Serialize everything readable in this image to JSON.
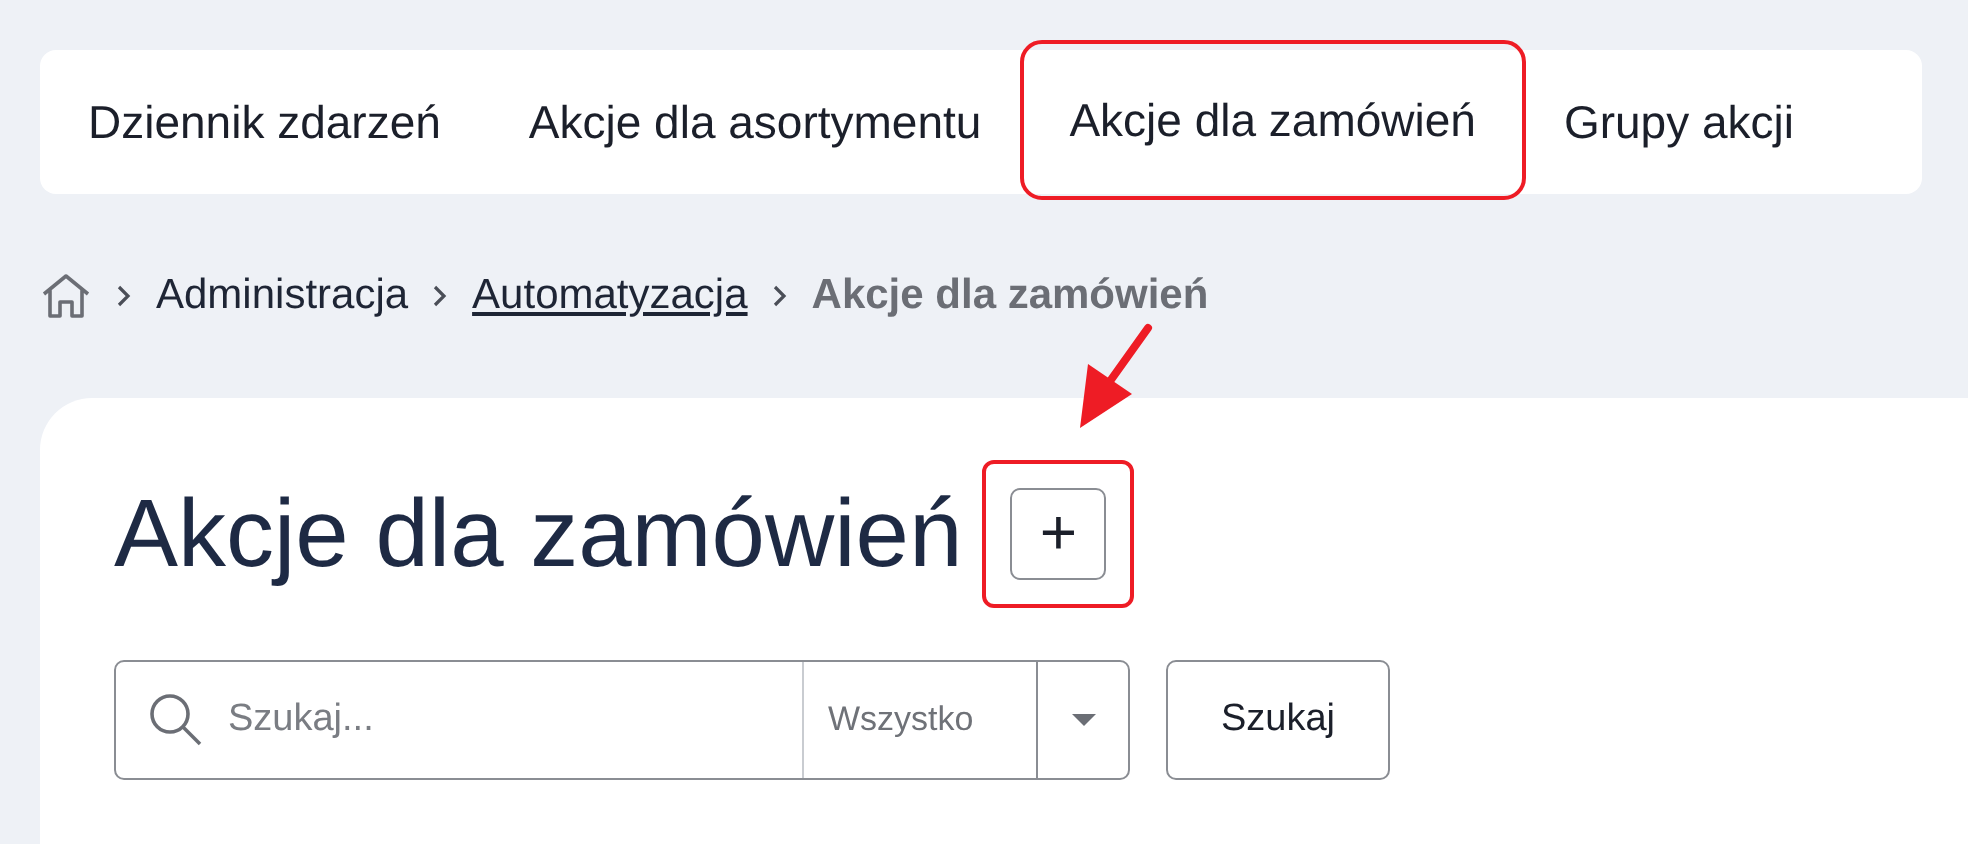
{
  "tabs": [
    {
      "label": "Dziennik zdarzeń",
      "highlighted": false
    },
    {
      "label": "Akcje dla asortymentu",
      "highlighted": false
    },
    {
      "label": "Akcje dla zamówień",
      "highlighted": true
    },
    {
      "label": "Grupy akcji",
      "highlighted": false
    }
  ],
  "breadcrumb": [
    {
      "label": "Administracja",
      "kind": "plain"
    },
    {
      "label": "Automatyzacja",
      "kind": "link"
    },
    {
      "label": "Akcje dla zamówień",
      "kind": "current"
    }
  ],
  "page_title": "Akcje dla zamówień",
  "add_button": {
    "label": "+",
    "highlighted": true
  },
  "search": {
    "placeholder": "Szukaj...",
    "filter": "Wszystko",
    "button": "Szukaj"
  }
}
